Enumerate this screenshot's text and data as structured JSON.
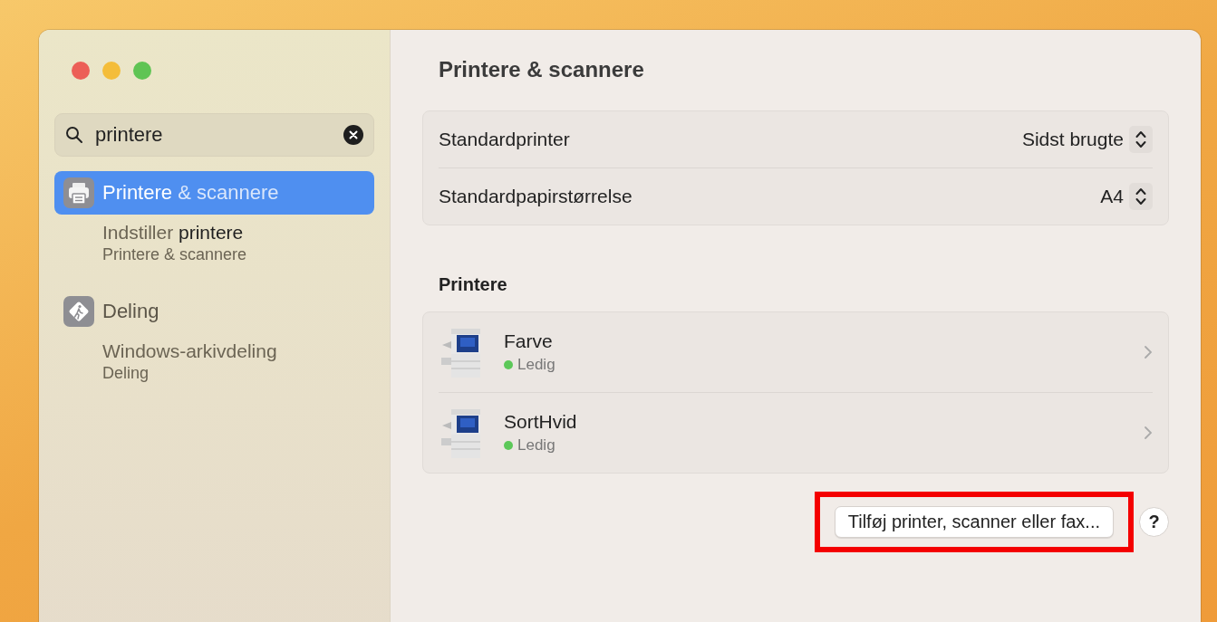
{
  "search": {
    "value": "printere"
  },
  "results": [
    {
      "kind": "pane",
      "label": "**Printere** & scannere",
      "selected": true
    },
    {
      "kind": "setting",
      "label": "Indstiller **printere**",
      "sub": "Printere & scannere",
      "selected": false
    },
    {
      "kind": "pane",
      "label": "Deling",
      "selected": false
    },
    {
      "kind": "setting",
      "label": "Windows-arkivdeling",
      "sub": "Deling",
      "selected": false
    }
  ],
  "title": "Printere & scannere",
  "settings": [
    {
      "label": "Standardprinter",
      "value": "Sidst brugte"
    },
    {
      "label": "Standardpapirstørrelse",
      "value": "A4"
    }
  ],
  "printers_heading": "Printere",
  "printers": [
    {
      "name": "Farve",
      "status": "Ledig",
      "color": "#5cc859"
    },
    {
      "name": "SortHvid",
      "status": "Ledig",
      "color": "#5cc859"
    }
  ],
  "add_button": {
    "label": "Tilføj printer, scanner eller fax...",
    "highlighted": true
  },
  "help_button": "?"
}
